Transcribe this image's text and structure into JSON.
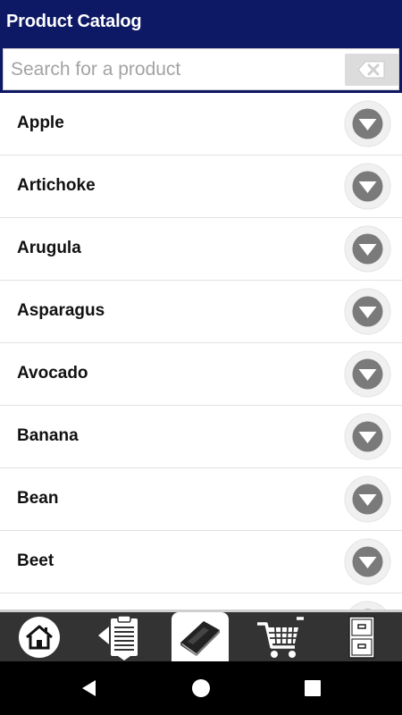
{
  "app": {
    "title": "Product Catalog"
  },
  "search": {
    "placeholder": "Search for a product",
    "value": ""
  },
  "products": [
    {
      "name": "Apple"
    },
    {
      "name": "Artichoke"
    },
    {
      "name": "Arugula"
    },
    {
      "name": "Asparagus"
    },
    {
      "name": "Avocado"
    },
    {
      "name": "Banana"
    },
    {
      "name": "Bean"
    },
    {
      "name": "Beet"
    }
  ],
  "tabs": [
    {
      "icon": "home-icon",
      "active": false
    },
    {
      "icon": "clipboard-list-icon",
      "active": false
    },
    {
      "icon": "catalog-book-icon",
      "active": true
    },
    {
      "icon": "shopping-cart-icon",
      "active": false
    },
    {
      "icon": "file-cabinet-icon",
      "active": false
    }
  ],
  "colors": {
    "header": "#0e1965",
    "tabbar": "#333333",
    "active_tab": "#ffffff"
  }
}
